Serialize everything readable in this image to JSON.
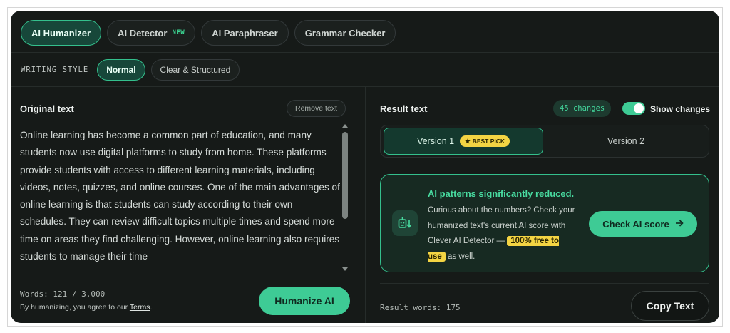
{
  "tabs": [
    {
      "label": "AI Humanizer",
      "active": true
    },
    {
      "label": "AI Detector",
      "badge": "NEW",
      "active": false
    },
    {
      "label": "AI Paraphraser",
      "active": false
    },
    {
      "label": "Grammar Checker",
      "active": false
    }
  ],
  "writing_style": {
    "label": "WRITING STYLE",
    "options": [
      {
        "label": "Normal",
        "active": true
      },
      {
        "label": "Clear & Structured",
        "active": false
      }
    ]
  },
  "original": {
    "title": "Original text",
    "remove_label": "Remove text",
    "text": "Online learning has become a common part of education, and many students now use digital platforms to study from home. These platforms provide students with access to different learning materials, including videos, notes, quizzes, and online courses. One of the main advantages of online learning is that students can study according to their own schedules. They can review difficult topics multiple times and spend more time on areas they find challenging. However, online learning also requires students to manage their time",
    "words": "Words: 121 / 3,000",
    "terms_prefix": "By humanizing, you agree to our ",
    "terms_link": "Terms",
    "terms_suffix": ".",
    "humanize_label": "Humanize AI"
  },
  "result": {
    "title": "Result text",
    "changes_badge": "45 changes",
    "show_changes_label": "Show changes",
    "show_changes_on": true,
    "versions": [
      {
        "label": "Version 1",
        "badge": "BEST PICK",
        "active": true
      },
      {
        "label": "Version 2",
        "active": false
      }
    ],
    "promo": {
      "title": "AI patterns significantly reduced.",
      "body": "Curious about the numbers? Check your humanized text's current AI score with Clever AI Detector —",
      "highlight": "100% free to use",
      "suffix": " as well.",
      "button_label": "Check AI score"
    },
    "words": "Result words: 175",
    "copy_label": "Copy Text"
  },
  "colors": {
    "background": "#161a18",
    "accent": "#3ecb95",
    "highlight": "#f4d443"
  }
}
